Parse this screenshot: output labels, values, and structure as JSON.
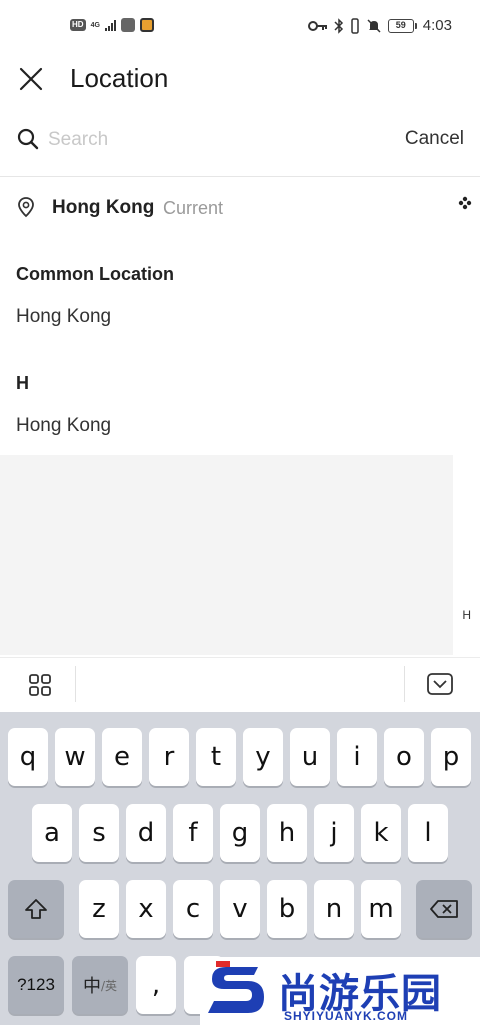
{
  "status_bar": {
    "hd_badge": "HD",
    "network": "4G",
    "time": "4:03",
    "battery": "59"
  },
  "header": {
    "title": "Location"
  },
  "search": {
    "placeholder": "Search",
    "value": "",
    "cancel_label": "Cancel"
  },
  "current": {
    "city": "Hong Kong",
    "tag": "Current"
  },
  "sections": [
    {
      "title": "Common Location",
      "items": [
        "Hong Kong"
      ]
    },
    {
      "title": "H",
      "items": [
        "Hong Kong"
      ]
    }
  ],
  "index_bar": [
    "H"
  ],
  "keyboard": {
    "row1": [
      "q",
      "w",
      "e",
      "r",
      "t",
      "y",
      "u",
      "i",
      "o",
      "p"
    ],
    "row2": [
      "a",
      "s",
      "d",
      "f",
      "g",
      "h",
      "j",
      "k",
      "l"
    ],
    "row3": [
      "z",
      "x",
      "c",
      "v",
      "b",
      "n",
      "m"
    ],
    "numbers_key": "?123",
    "lang_key": "中",
    "lang_sub": "/英",
    "comma_key": ","
  },
  "watermark": {
    "cn": "尚游乐园",
    "en": "SHYIYUANYK.COM"
  }
}
